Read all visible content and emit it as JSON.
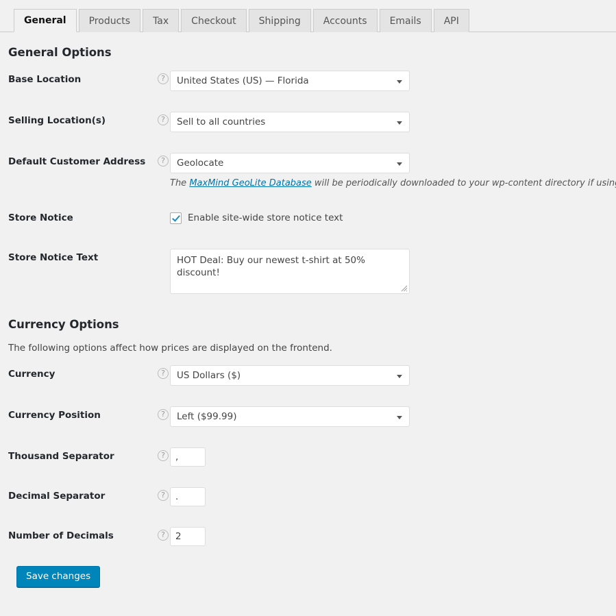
{
  "tabs": [
    {
      "label": "General",
      "active": true
    },
    {
      "label": "Products",
      "active": false
    },
    {
      "label": "Tax",
      "active": false
    },
    {
      "label": "Checkout",
      "active": false
    },
    {
      "label": "Shipping",
      "active": false
    },
    {
      "label": "Accounts",
      "active": false
    },
    {
      "label": "Emails",
      "active": false
    },
    {
      "label": "API",
      "active": false
    }
  ],
  "general_section": {
    "title": "General Options",
    "fields": {
      "base_location": {
        "label": "Base Location",
        "value": "United States (US) — Florida",
        "help_icon": "question-mark-circle-icon"
      },
      "selling_locations": {
        "label": "Selling Location(s)",
        "value": "Sell to all countries",
        "help_icon": "question-mark-circle-icon"
      },
      "default_customer_address": {
        "label": "Default Customer Address",
        "value": "Geolocate",
        "help_icon": "question-mark-circle-icon",
        "description_before": "The ",
        "description_link": "MaxMind GeoLite Database",
        "description_after": " will be periodically downloaded to your wp-content directory if using geolocation."
      },
      "store_notice": {
        "label": "Store Notice",
        "checkbox_label": "Enable site-wide store notice text",
        "checked": true
      },
      "store_notice_text": {
        "label": "Store Notice Text",
        "value": "HOT Deal: Buy our newest t-shirt at 50% discount!"
      }
    }
  },
  "currency_section": {
    "title": "Currency Options",
    "description": "The following options affect how prices are displayed on the frontend.",
    "fields": {
      "currency": {
        "label": "Currency",
        "value": "US Dollars ($)",
        "help_icon": "question-mark-circle-icon"
      },
      "currency_position": {
        "label": "Currency Position",
        "value": "Left ($99.99)",
        "help_icon": "question-mark-circle-icon"
      },
      "thousand_separator": {
        "label": "Thousand Separator",
        "value": ",",
        "help_icon": "question-mark-circle-icon"
      },
      "decimal_separator": {
        "label": "Decimal Separator",
        "value": ".",
        "help_icon": "question-mark-circle-icon"
      },
      "number_of_decimals": {
        "label": "Number of Decimals",
        "value": "2",
        "help_icon": "question-mark-circle-icon"
      }
    }
  },
  "footer": {
    "save_label": "Save changes"
  },
  "icons": {
    "help": "?",
    "dropdown_arrow": "chevron-down-icon"
  },
  "colors": {
    "page_background": "#f1f1f1",
    "primary_button": "#0085ba",
    "link": "#0073aa",
    "checkmark": "#1e8cbe",
    "heading": "#23282d"
  }
}
